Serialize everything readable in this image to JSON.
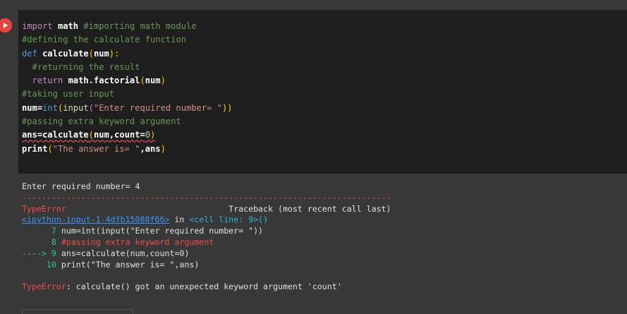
{
  "code_lines": [
    {
      "a": "import",
      "b": " math ",
      "c": "#importing math module"
    },
    {
      "c": "#defining the calculate function"
    },
    {
      "a": "def",
      "b": " calculate",
      "p1": "(",
      "n": "num",
      "p2": "):"
    },
    {
      "c": "  #returning the result"
    },
    {
      "a": "  return",
      "b": " math.factorial",
      "p1": "(",
      "n": "num",
      "p2": ")"
    },
    {
      "c": "#taking user input"
    },
    {
      "n": "num",
      "eq": "=",
      "f": "int",
      "p1": "(",
      "f2": "input",
      "p2": "(",
      "s": "\"Enter required number= \"",
      "p3": "))"
    },
    {
      "c": "#passing extra keyword argument"
    },
    {
      "n": "ans",
      "eq": "=",
      "b": "calculate",
      "p1": "(",
      "args": "num,count=",
      "num": "0",
      "p2": ")"
    },
    {
      "f": "print",
      "p1": "(",
      "s": "\"The answer is= \"",
      "args": ",ans",
      "p2": ")"
    }
  ],
  "output": {
    "prompt_line": "Enter required number= 4",
    "dashes": "---------------------------------------------------------------------------",
    "error_name": "TypeError",
    "traceback_header": "Traceback (most recent call last)",
    "link_text": "<ipython-input-1-4dfb15088f66>",
    "in_text": " in ",
    "cell_line": "<cell line: 9>()",
    "tb_lines": [
      {
        "num": "      7",
        "code": " num=int(input(\"Enter required number= \"))"
      },
      {
        "num": "      8",
        "code": " #passing extra keyword argument"
      },
      {
        "num": "----> 9",
        "code": " ans=calculate(num,count=0)"
      },
      {
        "num": "     10",
        "code": " print(\"The answer is= \",ans)"
      }
    ],
    "final_error_name": "TypeError",
    "final_error_msg": ": calculate() got an unexpected keyword argument 'count'"
  }
}
